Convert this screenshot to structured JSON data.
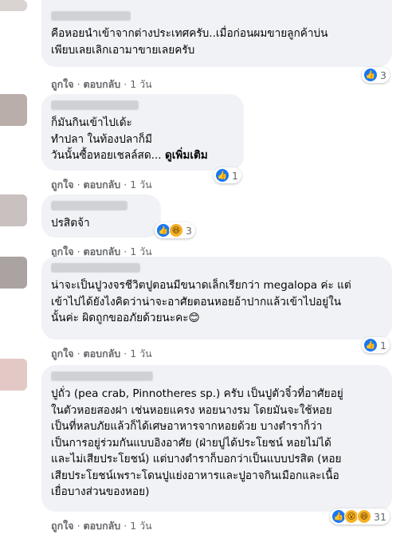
{
  "comments": [
    {
      "text": "คือหอยนำเข้าจากต่างประเทศครับ..เมื่อก่อนผมขายลูกค้าบ่น\nเพียบเลยเลิกเอามาขายเลยครับ",
      "see_more": "",
      "like": "ถูกใจ",
      "reply": "ตอบกลับ",
      "time": "1 วัน",
      "reaction_count": "3",
      "reactions": [
        "like-icon"
      ]
    },
    {
      "text": "ก็มันกินเข้าไปเด้ะ\nทำปลา ในท้องปลาก็มี\nวันนั้นซื้อหอยเชลล์สด... ",
      "see_more": "ดูเพิ่มเติม",
      "like": "ถูกใจ",
      "reply": "ตอบกลับ",
      "time": "1 วัน",
      "reaction_count": "1",
      "reactions": [
        "like-icon"
      ]
    },
    {
      "text": "ปรสิตจ้า",
      "see_more": "",
      "like": "ถูกใจ",
      "reply": "ตอบกลับ",
      "time": "1 วัน",
      "reaction_count": "3",
      "reactions": [
        "like-icon",
        "haha-icon"
      ]
    },
    {
      "text": "น่าจะเป็นปูวงจรชีวิตปูตอนมีขนาดเล็กเรียกว่า megalopa ค่ะ แต่\nเข้าไปได้ยังไงคิดว่าน่าจะอาศัยตอนหอยอ้าปากแล้วเข้าไปอยู่ใน\nนั้นค่ะ ผิดถูกขออภัยด้วยนะคะ😊",
      "see_more": "",
      "like": "ถูกใจ",
      "reply": "ตอบกลับ",
      "time": "1 วัน",
      "reaction_count": "1",
      "reactions": [
        "like-icon"
      ]
    },
    {
      "text": "ปูถั่ว (pea crab, Pinnotheres sp.) ครับ เป็นปูตัวจิ๋วที่อาศัยอยู่\nในตัวหอยสองฝา เช่นหอยแครง หอยนางรม โดยมันจะใช้หอย\nเป็นที่หลบภัยแล้วก็ได้เศษอาหารจากหอยด้วย บางตำราก็ว่า\nเป็นการอยู่ร่วมกันแบบอิงอาศัย (ฝ่ายปูได้ประโยชน์ หอยไม่ได้\nและไม่เสียประโยชน์) แต่บางตำราก็บอกว่าเป็นแบบปรสิต (หอย\nเสียประโยชน์เพราะโดนปูแย่งอาหารและปูอาจกินเมือกและเนื้อ\nเยื่อบางส่วนของหอย)",
      "see_more": "",
      "like": "ถูกใจ",
      "reply": "ตอบกลับ",
      "time": "1 วัน",
      "reaction_count": "31",
      "reactions": [
        "like-icon",
        "wow-icon",
        "haha-icon"
      ]
    }
  ],
  "colors": {
    "bubble_bg": "#f0f2f5",
    "meta_text": "#65676b",
    "like_blue": "#1877f2",
    "emoji_yellow": "#f7b125"
  }
}
